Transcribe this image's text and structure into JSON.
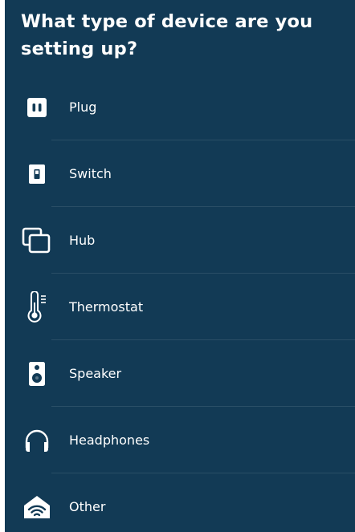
{
  "header": {
    "title": "What type of device are you setting up?"
  },
  "devices": [
    {
      "label": "Plug",
      "icon": "plug-icon"
    },
    {
      "label": "Switch",
      "icon": "switch-icon"
    },
    {
      "label": "Hub",
      "icon": "hub-icon"
    },
    {
      "label": "Thermostat",
      "icon": "thermostat-icon"
    },
    {
      "label": "Speaker",
      "icon": "speaker-icon"
    },
    {
      "label": "Headphones",
      "icon": "headphones-icon"
    },
    {
      "label": "Other",
      "icon": "wifi-home-icon"
    }
  ],
  "colors": {
    "background": "#123a55",
    "text": "#ffffff"
  }
}
